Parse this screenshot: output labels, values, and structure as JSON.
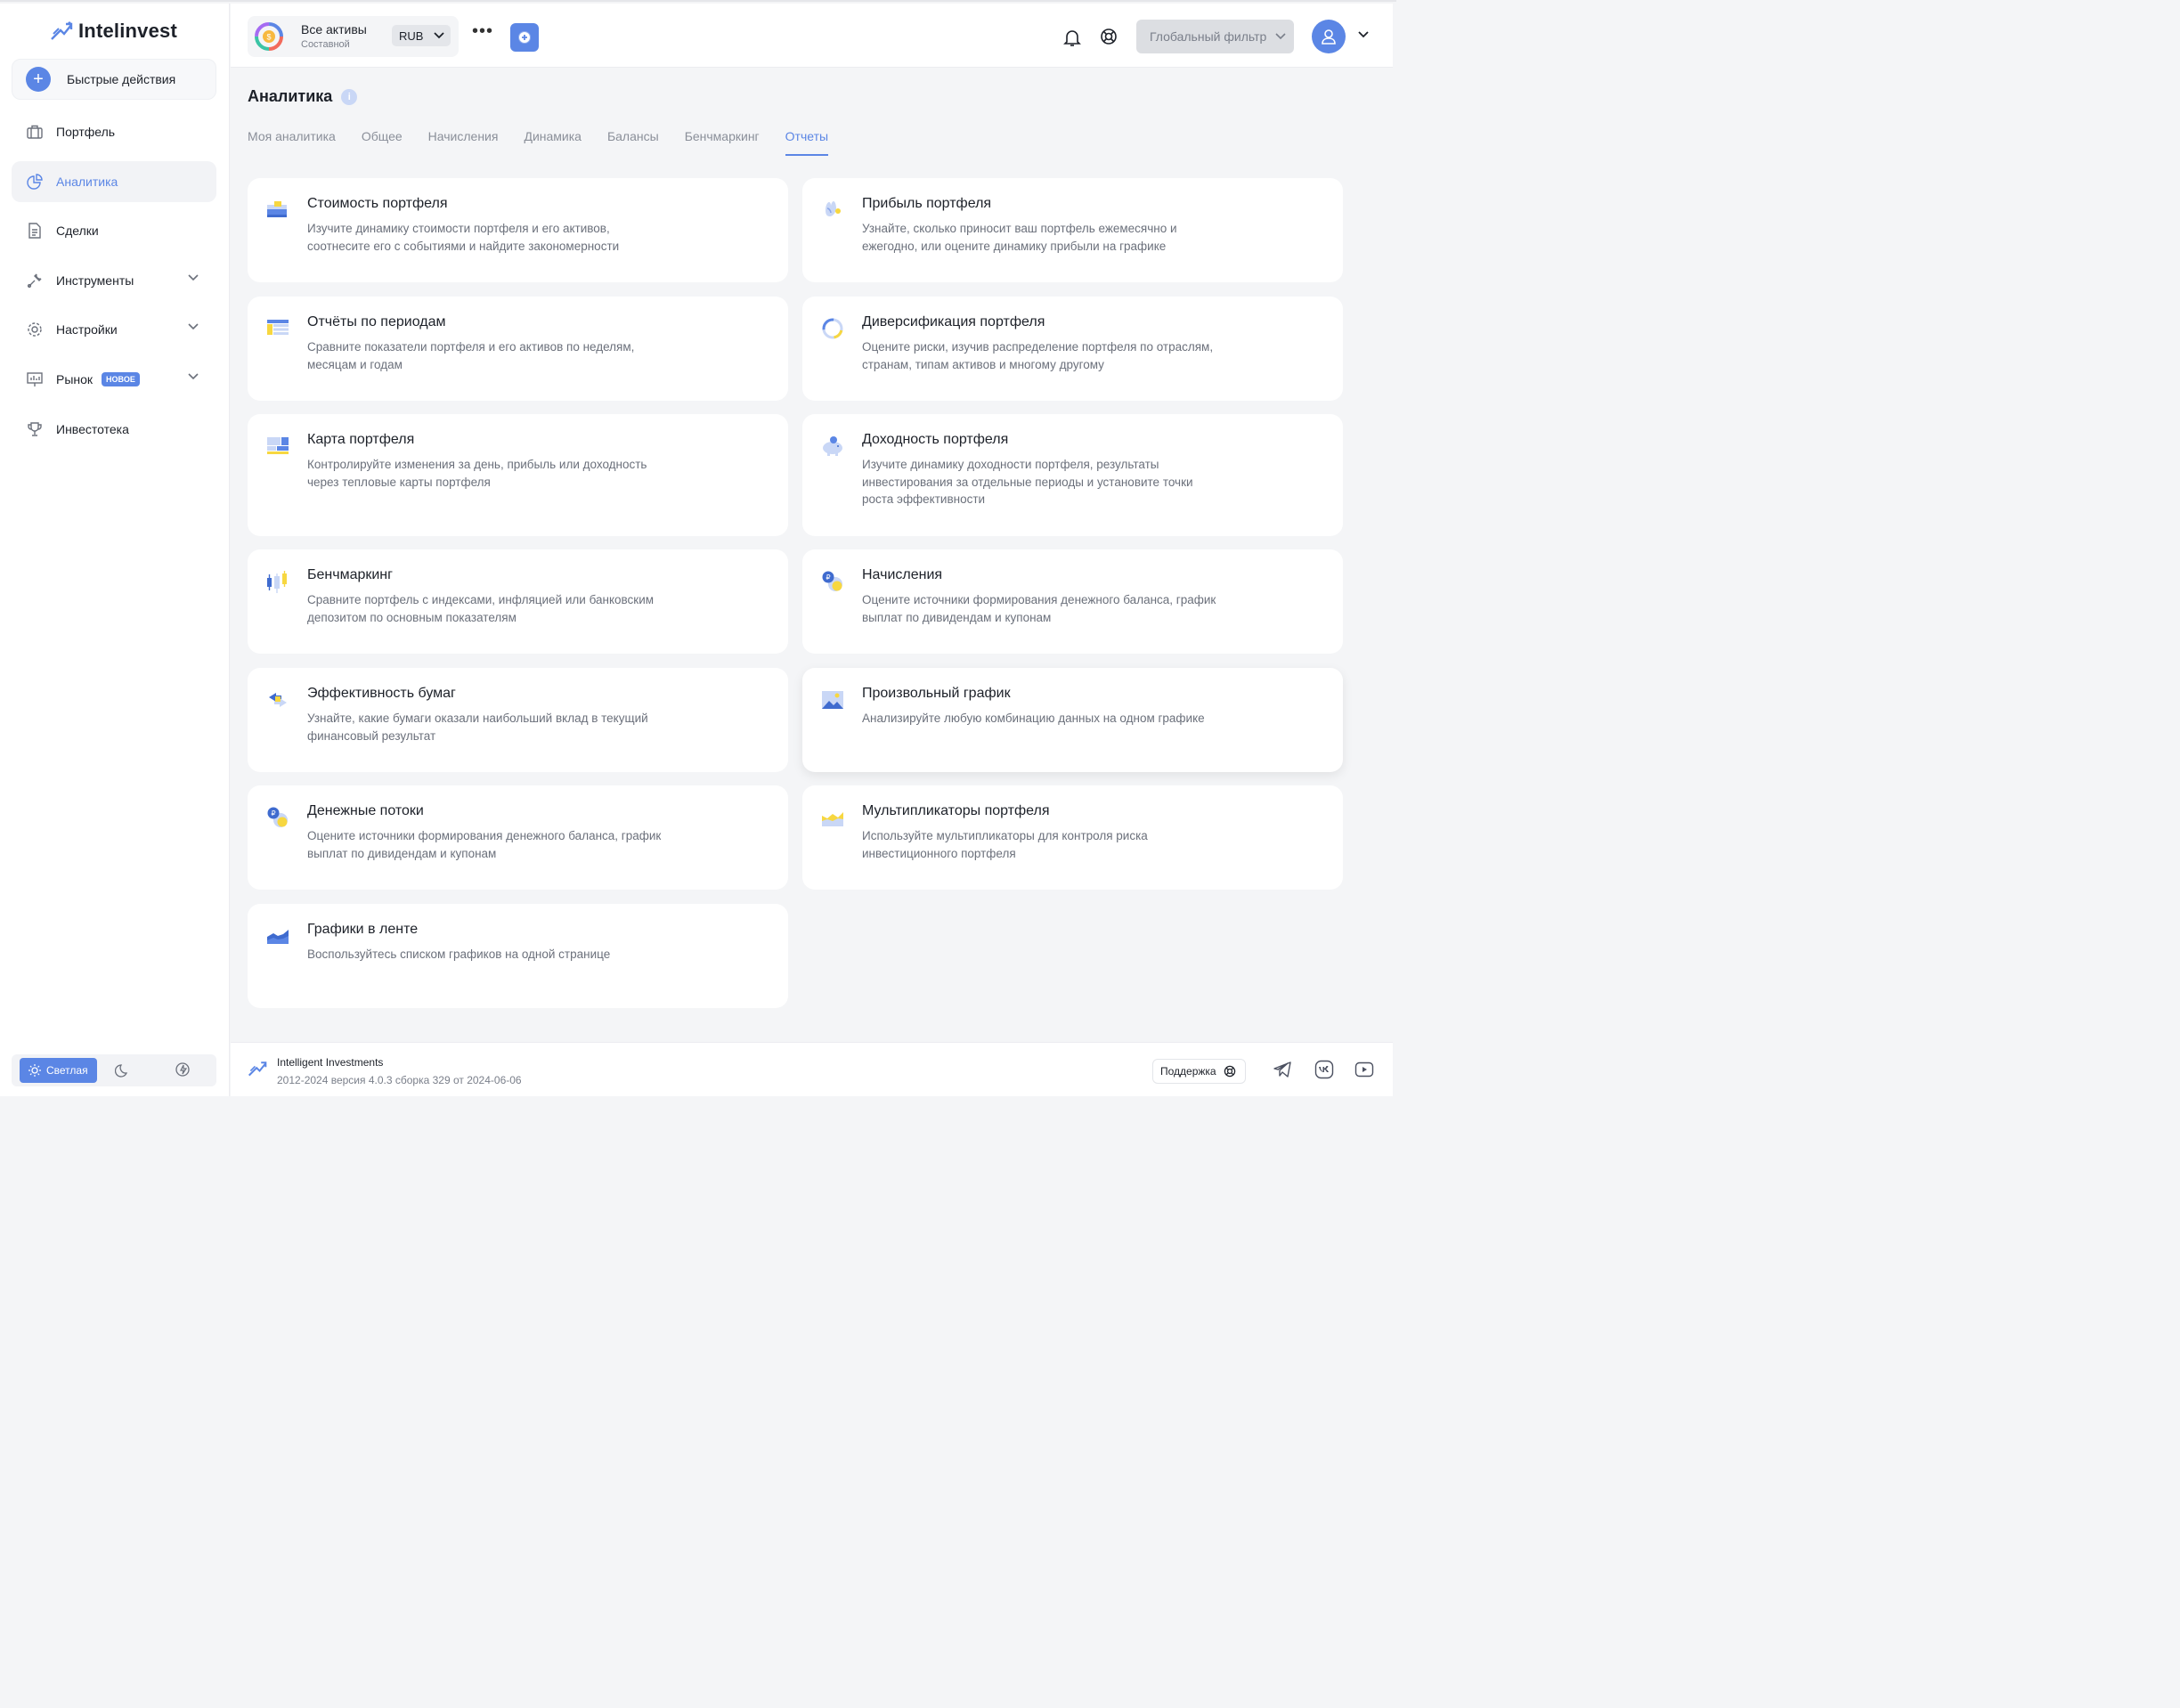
{
  "brand": {
    "name": "Intelinvest"
  },
  "quick_actions": {
    "label": "Быстрые действия"
  },
  "nav": {
    "items": [
      {
        "label": "Портфель"
      },
      {
        "label": "Аналитика"
      },
      {
        "label": "Сделки"
      },
      {
        "label": "Инструменты"
      },
      {
        "label": "Настройки"
      },
      {
        "label": "Рынок",
        "badge": "НОВОЕ"
      },
      {
        "label": "Инвестотека"
      }
    ]
  },
  "theme": {
    "light_label": "Светлая"
  },
  "topbar": {
    "portfolio_name": "Все активы",
    "portfolio_type": "Составной",
    "currency": "RUB",
    "global_filter": "Глобальный фильтр"
  },
  "page": {
    "title": "Аналитика"
  },
  "tabs": [
    {
      "label": "Моя аналитика"
    },
    {
      "label": "Общее"
    },
    {
      "label": "Начисления"
    },
    {
      "label": "Динамика"
    },
    {
      "label": "Балансы"
    },
    {
      "label": "Бенчмаркинг"
    },
    {
      "label": "Отчеты"
    }
  ],
  "cards": [
    {
      "title": "Стоимость портфеля",
      "desc": "Изучите динамику стоимости портфеля и его активов, соотнесите его с событиями и найдите закономерности",
      "icon": "wallet-icon"
    },
    {
      "title": "Прибыль портфеля",
      "desc": "Узнайте, сколько приносит ваш портфель ежемесячно и ежегодно, или оцените динамику прибыли на графике",
      "icon": "hand-coin-icon"
    },
    {
      "title": "Отчёты по периодам",
      "desc": "Сравните показатели портфеля и его активов по неделям, месяцам и годам",
      "icon": "table-icon"
    },
    {
      "title": "Диверсификация портфеля",
      "desc": "Оцените риски, изучив распределение портфеля по отраслям, странам, типам активов и многому другому",
      "icon": "donut-icon"
    },
    {
      "title": "Карта портфеля",
      "desc": "Контролируйте изменения за день, прибыль или доходность через тепловые карты портфеля",
      "icon": "heatmap-icon"
    },
    {
      "title": "Доходность портфеля",
      "desc": "Изучите динамику доходности портфеля, результаты инвестирования за отдельные периоды и установите точки роста эффективности",
      "icon": "piggy-bank-icon"
    },
    {
      "title": "Бенчмаркинг",
      "desc": "Сравните портфель с индексами, инфляцией или банковским депозитом по основным показателям",
      "icon": "candles-icon"
    },
    {
      "title": "Начисления",
      "desc": "Оцените источники формирования денежного баланса, график выплат по дивидендам и купонам",
      "icon": "coins-icon"
    },
    {
      "title": "Эффективность бумаг",
      "desc": "Узнайте, какие бумаги оказали наибольший вклад в текущий финансовый результат",
      "icon": "exchange-icon"
    },
    {
      "title": "Произвольный график",
      "desc": "Анализируйте любую комбинацию данных на одном графике",
      "icon": "image-chart-icon"
    },
    {
      "title": "Денежные потоки",
      "desc": "Оцените источники формирования денежного баланса, график выплат по дивидендам и купонам",
      "icon": "coins-flow-icon"
    },
    {
      "title": "Мультипликаторы портфеля",
      "desc": "Используйте мультипликаторы для контроля риска инвестиционного портфеля",
      "icon": "area-chart-icon"
    },
    {
      "title": "Графики в ленте",
      "desc": "Воспользуйтесь списком графиков на одной странице",
      "icon": "feed-chart-icon"
    }
  ],
  "footer": {
    "company": "Intelligent Investments",
    "version": "2012-2024 версия 4.0.3 сборка 329 от 2024-06-06",
    "support_label": "Поддержка"
  },
  "colors": {
    "accent": "#5b86e5",
    "yellow": "#f7d740",
    "bg": "#f4f5f7"
  }
}
